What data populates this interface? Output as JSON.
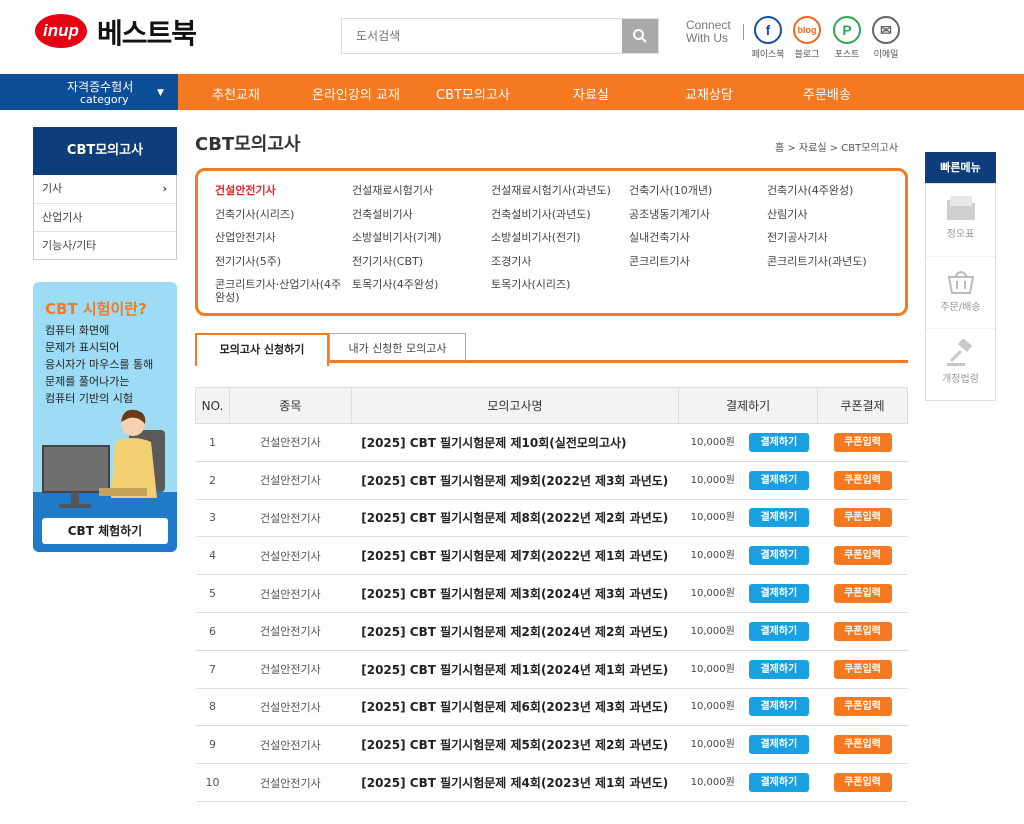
{
  "header": {
    "logo_badge": "inup",
    "logo_text": "베스트북",
    "search_placeholder": "도서검색",
    "connect_line1": "Connect",
    "connect_line2": "With Us",
    "social": [
      {
        "label": "페이스북",
        "glyph": "f",
        "icon": "facebook-icon",
        "color": "#1a4f9c"
      },
      {
        "label": "블로그",
        "glyph": "blog",
        "icon": "blog-icon",
        "color": "#e96b1b"
      },
      {
        "label": "포스트",
        "glyph": "P",
        "icon": "post-icon",
        "color": "#2fa84f"
      },
      {
        "label": "이메일",
        "glyph": "✉",
        "icon": "email-icon",
        "color": "#666666"
      }
    ]
  },
  "nav": {
    "category_line1": "자격증수험서",
    "category_line2": "category",
    "items": [
      "추천교재",
      "온라인강의 교재",
      "CBT모의고사",
      "자료실",
      "교재상담",
      "주문배송"
    ]
  },
  "sidebar": {
    "title": "CBT모의고사",
    "items": [
      "기사",
      "산업기사",
      "기능사/기타"
    ],
    "banner_title": "CBT 시험이란?",
    "banner_lines": [
      "컴퓨터 화면에",
      "문제가 표시되어",
      "응시자가 마우스를 통해",
      "문제를 풀어나가는",
      "컴퓨터 기반의 시험"
    ],
    "banner_button": "CBT 체험하기"
  },
  "main": {
    "title": "CBT모의고사",
    "breadcrumb": "홈 > 자료실 > CBT모의고사",
    "categories": [
      "건설안전기사",
      "건설재료시험기사",
      "건설재료시험기사(과년도)",
      "건축기사(10개년)",
      "건축기사(4주완성)",
      "건축기사(시리즈)",
      "건축설비기사",
      "건축설비기사(과년도)",
      "공조냉동기계기사",
      "산림기사",
      "산업안전기사",
      "소방설비기사(기계)",
      "소방설비기사(전기)",
      "실내건축기사",
      "전기공사기사",
      "전기기사(5주)",
      "전기기사(CBT)",
      "조경기사",
      "콘크리트기사",
      "콘크리트기사(과년도)",
      "콘크리트기사·산업기사(4주완성)",
      "토목기사(4주완성)",
      "토목기사(시리즈)"
    ],
    "tabs": [
      "모의고사 신청하기",
      "내가 신청한 모의고사"
    ],
    "columns": [
      "NO.",
      "종목",
      "모의고사명",
      "결제하기",
      "쿠폰결제"
    ],
    "pay_label": "결제하기",
    "coupon_label": "쿠폰입력",
    "rows": [
      {
        "no": "1",
        "subject": "건설안전기사",
        "name": "[2025] CBT 필기시험문제 제10회(실전모의고사)",
        "price": "10,000원"
      },
      {
        "no": "2",
        "subject": "건설안전기사",
        "name": "[2025] CBT 필기시험문제 제9회(2022년 제3회 과년도)",
        "price": "10,000원"
      },
      {
        "no": "3",
        "subject": "건설안전기사",
        "name": "[2025] CBT 필기시험문제 제8회(2022년 제2회 과년도)",
        "price": "10,000원"
      },
      {
        "no": "4",
        "subject": "건설안전기사",
        "name": "[2025] CBT 필기시험문제 제7회(2022년 제1회 과년도)",
        "price": "10,000원"
      },
      {
        "no": "5",
        "subject": "건설안전기사",
        "name": "[2025] CBT 필기시험문제 제3회(2024년 제3회 과년도)",
        "price": "10,000원"
      },
      {
        "no": "6",
        "subject": "건설안전기사",
        "name": "[2025] CBT 필기시험문제 제2회(2024년 제2회 과년도)",
        "price": "10,000원"
      },
      {
        "no": "7",
        "subject": "건설안전기사",
        "name": "[2025] CBT 필기시험문제 제1회(2024년 제1회 과년도)",
        "price": "10,000원"
      },
      {
        "no": "8",
        "subject": "건설안전기사",
        "name": "[2025] CBT 필기시험문제 제6회(2023년 제3회 과년도)",
        "price": "10,000원"
      },
      {
        "no": "9",
        "subject": "건설안전기사",
        "name": "[2025] CBT 필기시험문제 제5회(2023년 제2회 과년도)",
        "price": "10,000원"
      },
      {
        "no": "10",
        "subject": "건설안전기사",
        "name": "[2025] CBT 필기시험문제 제4회(2023년 제1회 과년도)",
        "price": "10,000원"
      }
    ]
  },
  "quick_menu": {
    "title": "빠른메뉴",
    "items": [
      {
        "label": "정오표",
        "icon": "folder-icon"
      },
      {
        "label": "주문/배송",
        "icon": "basket-icon"
      },
      {
        "label": "개정법령",
        "icon": "gavel-icon"
      }
    ]
  },
  "colors": {
    "brand_orange": "#f47920",
    "nav_blue": "#0d4e99",
    "pay_blue": "#1aa0e0",
    "active_red": "#e5232e"
  }
}
